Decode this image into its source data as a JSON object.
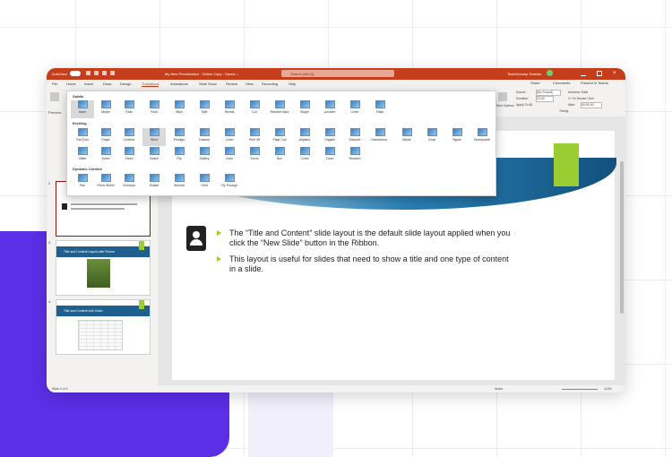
{
  "titlebar": {
    "autosave": "AutoSave",
    "doc_title": "My New Presentation · Online Copy · Saved ⌄",
    "search": "Search (Alt+Q)",
    "user": "TeachUcomp Teacher"
  },
  "menubar": {
    "tabs": [
      "File",
      "Home",
      "Insert",
      "Draw",
      "Design",
      "Transitions",
      "Animations",
      "Slide Show",
      "Review",
      "View",
      "Recording",
      "Help"
    ],
    "active_index": 5,
    "share": "Share",
    "comments": "Comments",
    "present": "Present in Teams"
  },
  "ribbon": {
    "preview_label": "Preview",
    "effect_options": "Effect Options",
    "sound_label": "Sound:",
    "sound_value": "[No Sound]",
    "duration_label": "Duration:",
    "duration_value": "02.00",
    "apply_to_all": "Apply To All",
    "advance_label": "Advance Slide",
    "on_mouse_click": "On Mouse Click",
    "after_label": "After:",
    "after_value": "00:00.00",
    "timing_label": "Timing"
  },
  "gallery": {
    "subtle_header": "Subtle",
    "subtle": [
      "None",
      "Morph",
      "Fade",
      "Push",
      "Wipe",
      "Split",
      "Reveal",
      "Cut",
      "Random Bars",
      "Shape",
      "Uncover",
      "Cover",
      "Flash"
    ],
    "exciting_header": "Exciting",
    "exciting_row1": [
      "Fall Over",
      "Drape",
      "Curtains",
      "Wind",
      "Prestige",
      "Fracture",
      "Crush",
      "Peel Off",
      "Page Curl",
      "Airplane",
      "Origami",
      "Dissolve",
      "Checkerboa...",
      "Blinds",
      "Clock",
      "Ripple",
      "Honeycomb"
    ],
    "exciting_row2": [
      "Glitter",
      "Vortex",
      "Shred",
      "Switch",
      "Flip",
      "Gallery",
      "Cube",
      "Doors",
      "Box",
      "Comb",
      "Zoom",
      "Random"
    ],
    "dynamic_header": "Dynamic Content",
    "dynamic": [
      "Pan",
      "Ferris Wheel",
      "Conveyor",
      "Rotate",
      "Window",
      "Orbit",
      "Fly Through"
    ],
    "selected": "Wind"
  },
  "thumbnails": [
    {
      "number": "2"
    },
    {
      "number": "3",
      "title": "Title and Content Layout with Picture"
    },
    {
      "number": "4",
      "title": "Title and Content with Video"
    }
  ],
  "slide": {
    "bullets": [
      "The “Title and Content” slide layout is the default slide layout applied when you click the “New Slide” button in the Ribbon.",
      "This layout is useful for slides that need to show a title and one type of content in a slide."
    ]
  },
  "statusbar": {
    "slide_info": "Slide 2 of 4",
    "notes": "Notes",
    "zoom": "113%"
  },
  "colors": {
    "titlebar": "#c43e1c",
    "purple_block": "#5b2fe6",
    "accent_green": "#9acd32",
    "slide_blue": "#1e5f8d"
  }
}
